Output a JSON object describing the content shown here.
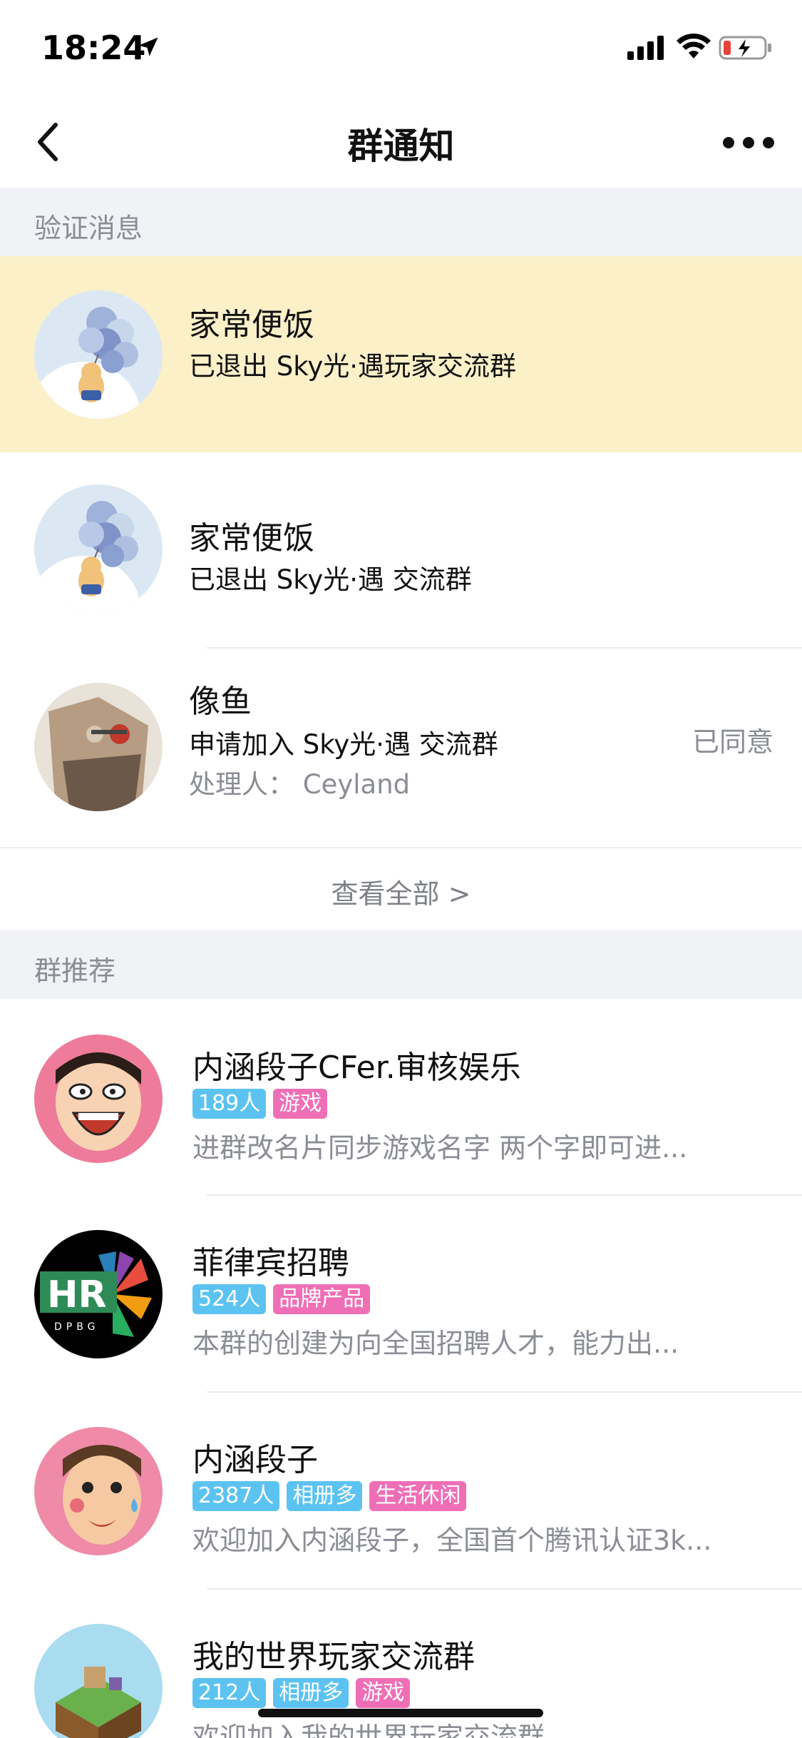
{
  "status_bar": {
    "time": "18:24"
  },
  "nav": {
    "title": "群通知"
  },
  "verify_section": {
    "header": "验证消息",
    "items": [
      {
        "name": "家常便饭",
        "action": "已退出 Sky光·遇玩家交流群",
        "highlighted": true
      },
      {
        "name": "家常便饭",
        "action": "已退出 Sky光·遇 交流群",
        "highlighted": false
      },
      {
        "name": "像鱼",
        "action": "申请加入 Sky光·遇 交流群",
        "handler": "处理人： Ceyland",
        "status": "已同意"
      }
    ],
    "view_all": "查看全部 >"
  },
  "recommend_section": {
    "header": "群推荐",
    "groups": [
      {
        "name": "内涵段子CFer.审核娱乐",
        "tags": [
          {
            "text": "189人",
            "color": "#5cc3f1"
          },
          {
            "text": "游戏",
            "color": "#ef6fb6"
          }
        ],
        "desc": "进群改名片同步游戏名字 两个字即可进..."
      },
      {
        "name": "菲律宾招聘",
        "tags": [
          {
            "text": "524人",
            "color": "#5cc3f1"
          },
          {
            "text": "品牌产品",
            "color": "#ef6fb6"
          }
        ],
        "desc": "本群的创建为向全国招聘人才，能力出..."
      },
      {
        "name": "内涵段子",
        "tags": [
          {
            "text": "2387人",
            "color": "#5cc3f1"
          },
          {
            "text": "相册多",
            "color": "#5cc3f1"
          },
          {
            "text": "生活休闲",
            "color": "#ef6fb6"
          }
        ],
        "desc": "欢迎加入内涵段子，全国首个腾讯认证3k..."
      },
      {
        "name": "我的世界玩家交流群",
        "tags": [
          {
            "text": "212人",
            "color": "#5cc3f1"
          },
          {
            "text": "相册多",
            "color": "#5cc3f1"
          },
          {
            "text": "游戏",
            "color": "#ef6fb6"
          }
        ],
        "desc": "欢迎加入我的世界玩家交流群"
      }
    ]
  },
  "avatars": {
    "hr_logo_text": "HR",
    "hr_logo_sub": "DPBG"
  }
}
